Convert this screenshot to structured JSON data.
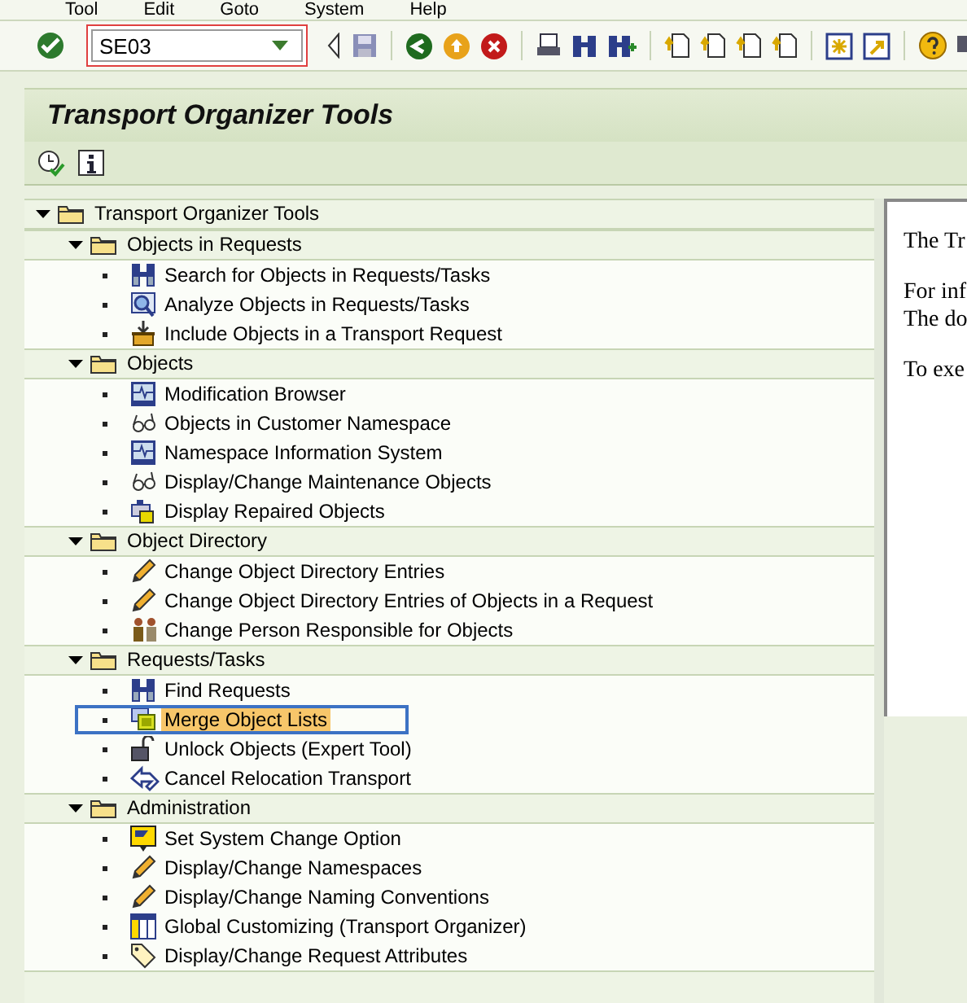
{
  "menu_bar": [
    "Tool",
    "Edit",
    "Goto",
    "System",
    "Help"
  ],
  "command_field": {
    "value": "SE03"
  },
  "title": "Transport Organizer Tools",
  "tree": {
    "label": "Transport Organizer Tools",
    "expanded": true,
    "children": [
      {
        "label": "Objects in Requests",
        "expanded": true,
        "children": [
          {
            "label": "Search for Objects in Requests/Tasks",
            "kind": "binoculars",
            "selected": false
          },
          {
            "label": "Analyze Objects in Requests/Tasks",
            "kind": "analyze",
            "selected": false
          },
          {
            "label": "Include Objects in a Transport Request",
            "kind": "include",
            "selected": false
          }
        ]
      },
      {
        "label": "Objects",
        "expanded": true,
        "children": [
          {
            "label": "Modification Browser",
            "kind": "monitor",
            "selected": false
          },
          {
            "label": "Objects in Customer Namespace",
            "kind": "glasses",
            "selected": false
          },
          {
            "label": "Namespace Information System",
            "kind": "monitor",
            "selected": false
          },
          {
            "label": "Display/Change Maintenance Objects",
            "kind": "glasses",
            "selected": false
          },
          {
            "label": "Display Repaired Objects",
            "kind": "repaired",
            "selected": false
          }
        ]
      },
      {
        "label": "Object Directory",
        "expanded": true,
        "children": [
          {
            "label": "Change Object Directory Entries",
            "kind": "pencil",
            "selected": false
          },
          {
            "label": "Change Object Directory Entries of Objects in a Request",
            "kind": "pencil",
            "selected": false
          },
          {
            "label": "Change Person Responsible for Objects",
            "kind": "persons",
            "selected": false
          }
        ]
      },
      {
        "label": "Requests/Tasks",
        "expanded": true,
        "children": [
          {
            "label": "Find Requests",
            "kind": "binoculars",
            "selected": false
          },
          {
            "label": "Merge Object Lists",
            "kind": "merge",
            "selected": true
          },
          {
            "label": "Unlock Objects (Expert Tool)",
            "kind": "unlock",
            "selected": false
          },
          {
            "label": "Cancel Relocation Transport",
            "kind": "cancel",
            "selected": false
          }
        ]
      },
      {
        "label": "Administration",
        "expanded": true,
        "children": [
          {
            "label": "Set System Change Option",
            "kind": "flag",
            "selected": false
          },
          {
            "label": "Display/Change Namespaces",
            "kind": "pencil",
            "selected": false
          },
          {
            "label": "Display/Change Naming Conventions",
            "kind": "pencil",
            "selected": false
          },
          {
            "label": "Global Customizing (Transport Organizer)",
            "kind": "table",
            "selected": false
          },
          {
            "label": "Display/Change Request Attributes",
            "kind": "tag",
            "selected": false
          }
        ]
      }
    ]
  },
  "info_panel": [
    "The Tr",
    "For inf",
    "The do",
    "To exe"
  ]
}
